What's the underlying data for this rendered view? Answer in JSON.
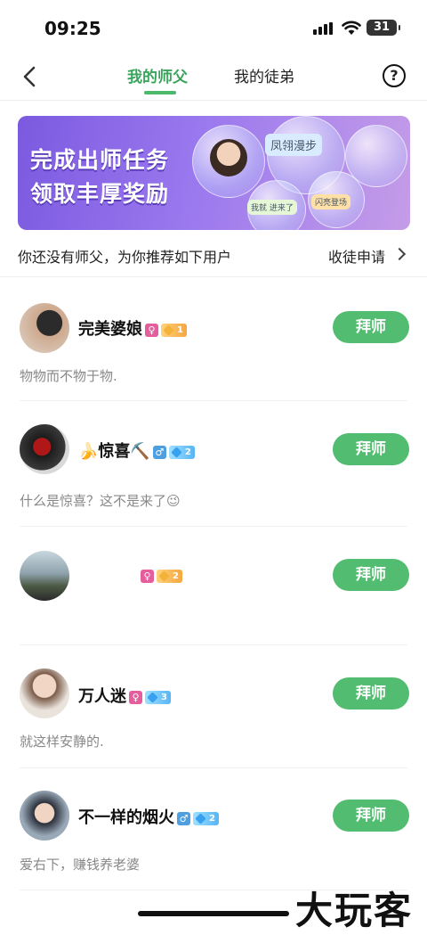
{
  "status_bar": {
    "time": "09:25",
    "battery": "31"
  },
  "nav": {
    "tabs": [
      {
        "label": "我的师父",
        "active": true
      },
      {
        "label": "我的徒弟",
        "active": false
      }
    ],
    "help_label": "?"
  },
  "banner": {
    "line1": "完成出师任务",
    "line2": "领取丰厚奖励",
    "tags": [
      "凤翎漫步",
      "闪亮登场",
      "我就 进来了"
    ]
  },
  "hint_text": "你还没有师父，为你推荐如下用户",
  "apply_link": "收徒申请",
  "users": [
    {
      "name": "完美婆娘",
      "gender": "female",
      "gender_symbol": "♀",
      "level": "1",
      "level_style": "gold",
      "bio": "物物而不物于物.",
      "action": "拜师"
    },
    {
      "name": "🍌惊喜⛏️",
      "gender": "male",
      "gender_symbol": "♂",
      "level": "2",
      "level_style": "blue",
      "bio": "什么是惊喜？这不是来了😉",
      "action": "拜师"
    },
    {
      "name": "",
      "gender": "female",
      "gender_symbol": "♀",
      "level": "2",
      "level_style": "gold",
      "bio": "",
      "action": "拜师"
    },
    {
      "name": "万人迷",
      "gender": "female",
      "gender_symbol": "♀",
      "level": "3",
      "level_style": "blue",
      "bio": "就这样安静的.",
      "action": "拜师"
    },
    {
      "name": "不一样的烟火",
      "gender": "male",
      "gender_symbol": "♂",
      "level": "2",
      "level_style": "blue",
      "bio": "爱右下，赚钱养老婆",
      "action": "拜师"
    }
  ],
  "watermark": "大玩客",
  "colors": {
    "accent": "#52bd70",
    "tab_active": "#3aa45c",
    "female": "#e65d9d",
    "male": "#4e9fe0"
  }
}
